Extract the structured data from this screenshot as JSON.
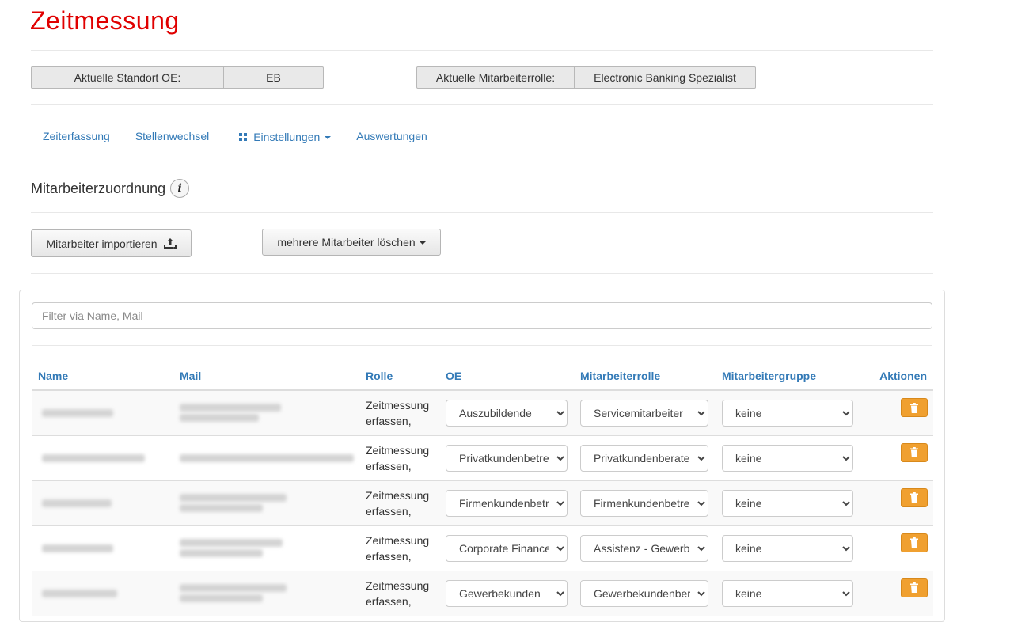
{
  "app": {
    "title": "Zeitmessung"
  },
  "info": {
    "standort_label": "Aktuelle Standort OE:",
    "standort_value": "EB",
    "rolle_label": "Aktuelle Mitarbeiterrolle:",
    "rolle_value": "Electronic Banking Spezialist"
  },
  "nav": {
    "items": [
      {
        "label": "Zeiterfassung"
      },
      {
        "label": "Stellenwechsel"
      },
      {
        "label": "Einstellungen",
        "icon": "grid-icon",
        "dropdown": true
      },
      {
        "label": "Auswertungen"
      }
    ]
  },
  "section": {
    "title": "Mitarbeiterzuordnung",
    "info_icon": "info-icon"
  },
  "toolbar": {
    "import_label": "Mitarbeiter importieren",
    "import_icon": "upload-icon",
    "bulk_delete_label": "mehrere Mitarbeiter löschen"
  },
  "filter": {
    "placeholder": "Filter via Name, Mail",
    "value": ""
  },
  "table": {
    "headers": [
      "Name",
      "Mail",
      "Rolle",
      "OE",
      "Mitarbeiterrolle",
      "Mitarbeitergruppe",
      "Aktionen"
    ],
    "rows": [
      {
        "rolle_line1": "Zeitmessung",
        "rolle_line2": "erfassen,",
        "oe": "Auszubildende",
        "mitarbeiterrolle": "Servicemitarbeiter",
        "gruppe": "keine"
      },
      {
        "rolle_line1": "Zeitmessung",
        "rolle_line2": "erfassen,",
        "oe": "Privatkundenbetreuung",
        "mitarbeiterrolle": "Privatkundenberater",
        "gruppe": "keine"
      },
      {
        "rolle_line1": "Zeitmessung",
        "rolle_line2": "erfassen,",
        "oe": "Firmenkundenbetreuung",
        "mitarbeiterrolle": "Firmenkundenbetreuer",
        "gruppe": "keine"
      },
      {
        "rolle_line1": "Zeitmessung",
        "rolle_line2": "erfassen,",
        "oe": "Corporate Finance",
        "mitarbeiterrolle": "Assistenz - Gewerbe",
        "gruppe": "keine"
      },
      {
        "rolle_line1": "Zeitmessung",
        "rolle_line2": "erfassen,",
        "oe": "Gewerbekunden",
        "mitarbeiterrolle": "Gewerbekundenberater",
        "gruppe": "keine"
      }
    ]
  },
  "colors": {
    "title": "#e00000",
    "link": "#337ab7",
    "delete": "#f0a030"
  }
}
